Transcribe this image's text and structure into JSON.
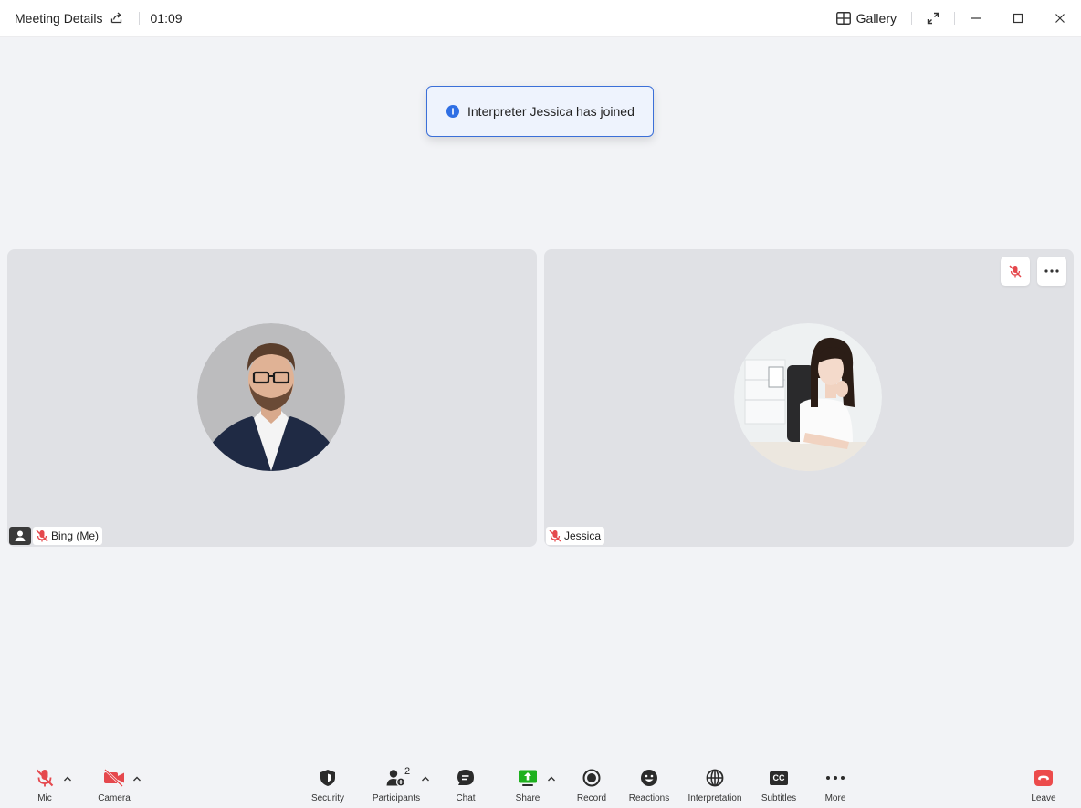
{
  "titlebar": {
    "meeting_details": "Meeting Details",
    "timer": "01:09",
    "gallery": "Gallery"
  },
  "toast": {
    "message": "Interpreter Jessica has joined",
    "icon": "info-icon"
  },
  "tiles": [
    {
      "name": "Bing (Me)",
      "muted": true
    },
    {
      "name": "Jessica",
      "muted": true
    }
  ],
  "toolbar": {
    "mic": "Mic",
    "camera": "Camera",
    "security": "Security",
    "participants": "Participants",
    "participants_count": "2",
    "chat": "Chat",
    "share": "Share",
    "record": "Record",
    "reactions": "Reactions",
    "interpretation": "Interpretation",
    "subtitles": "Subtitles",
    "subtitles_icon_text": "CC",
    "more": "More",
    "leave": "Leave"
  },
  "colors": {
    "muted_red": "#e5484d",
    "share_green": "#1fb11f",
    "leave_red": "#ec4b4b",
    "toast_border": "#3b6fd8",
    "info_blue": "#2f6fe4"
  }
}
